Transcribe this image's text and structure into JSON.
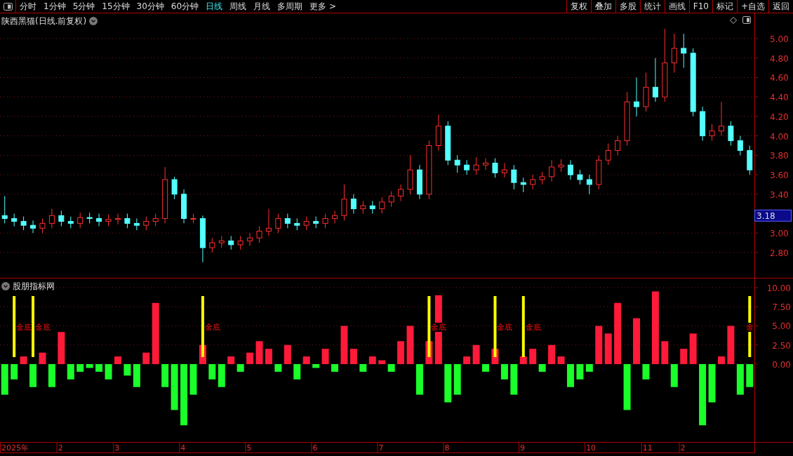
{
  "toolbar": {
    "periods": [
      {
        "label": "分时",
        "selected": false
      },
      {
        "label": "1分钟",
        "selected": false
      },
      {
        "label": "5分钟",
        "selected": false
      },
      {
        "label": "15分钟",
        "selected": false
      },
      {
        "label": "30分钟",
        "selected": false
      },
      {
        "label": "60分钟",
        "selected": false
      },
      {
        "label": "日线",
        "selected": true
      },
      {
        "label": "周线",
        "selected": false
      },
      {
        "label": "月线",
        "selected": false
      },
      {
        "label": "多周期",
        "selected": false
      },
      {
        "label": "更多 >",
        "selected": false
      }
    ],
    "actions": [
      "复权",
      "叠加",
      "多股",
      "统计",
      "画线",
      "F10",
      "标记",
      "+自选",
      "返回"
    ]
  },
  "price_panel": {
    "title": "陕西黑猫(日线.前复权)",
    "current_price": "3.18",
    "chart_data": {
      "type": "candlestick",
      "grid": true,
      "ylim": [
        2.54,
        5.26
      ],
      "categories": [
        null,
        null,
        null,
        null,
        null,
        null,
        null,
        null,
        null,
        null,
        null,
        null,
        null,
        null,
        null,
        null,
        null,
        null,
        null,
        null,
        null,
        null,
        null,
        null,
        null,
        null,
        null,
        null,
        null,
        null,
        null,
        null,
        null,
        null,
        null,
        null,
        null,
        null,
        null,
        null,
        null,
        null,
        null,
        null,
        null,
        null,
        null,
        null,
        null,
        null,
        null,
        null,
        null,
        null,
        null,
        null,
        null,
        null,
        null,
        null,
        null,
        null,
        null,
        null,
        null,
        null,
        null,
        null,
        null,
        null,
        null,
        null,
        null,
        null,
        null,
        null,
        null,
        null,
        null,
        null
      ],
      "yticks": [
        {
          "value": 2.8,
          "label": "2.80"
        },
        {
          "value": 3.0,
          "label": "3.00"
        },
        {
          "value": 3.4,
          "label": "3.40"
        },
        {
          "value": 3.6,
          "label": "3.60"
        },
        {
          "value": 3.8,
          "label": "3.80"
        },
        {
          "value": 4.0,
          "label": "4.00"
        },
        {
          "value": 4.2,
          "label": "4.20"
        },
        {
          "value": 4.4,
          "label": "4.40"
        },
        {
          "value": 4.6,
          "label": "4.60"
        },
        {
          "value": 4.8,
          "label": "4.80"
        },
        {
          "value": 5.0,
          "label": "5.00"
        }
      ],
      "ohlc": [
        [
          3.18,
          3.38,
          3.1,
          3.15
        ],
        [
          3.15,
          3.2,
          3.07,
          3.12
        ],
        [
          3.12,
          3.17,
          3.03,
          3.08
        ],
        [
          3.08,
          3.13,
          3.0,
          3.05
        ],
        [
          3.05,
          3.15,
          3.0,
          3.1
        ],
        [
          3.1,
          3.25,
          3.05,
          3.18
        ],
        [
          3.18,
          3.23,
          3.07,
          3.12
        ],
        [
          3.12,
          3.17,
          3.05,
          3.1
        ],
        [
          3.1,
          3.21,
          3.05,
          3.16
        ],
        [
          3.16,
          3.21,
          3.1,
          3.15
        ],
        [
          3.15,
          3.2,
          3.07,
          3.12
        ],
        [
          3.12,
          3.19,
          3.07,
          3.14
        ],
        [
          3.14,
          3.2,
          3.09,
          3.15
        ],
        [
          3.15,
          3.2,
          3.05,
          3.1
        ],
        [
          3.1,
          3.15,
          3.03,
          3.08
        ],
        [
          3.08,
          3.17,
          3.03,
          3.12
        ],
        [
          3.12,
          3.2,
          3.07,
          3.15
        ],
        [
          3.15,
          3.68,
          3.1,
          3.55
        ],
        [
          3.55,
          3.58,
          3.35,
          3.4
        ],
        [
          3.4,
          3.45,
          3.1,
          3.15
        ],
        [
          3.15,
          3.2,
          3.1,
          3.15
        ],
        [
          3.15,
          3.18,
          2.7,
          2.85
        ],
        [
          2.85,
          2.95,
          2.8,
          2.9
        ],
        [
          2.9,
          2.97,
          2.85,
          2.92
        ],
        [
          2.92,
          2.97,
          2.83,
          2.88
        ],
        [
          2.88,
          2.97,
          2.83,
          2.92
        ],
        [
          2.92,
          3.0,
          2.87,
          2.95
        ],
        [
          2.95,
          3.07,
          2.9,
          3.02
        ],
        [
          3.02,
          3.25,
          2.97,
          3.05
        ],
        [
          3.05,
          3.2,
          3.0,
          3.15
        ],
        [
          3.15,
          3.2,
          3.05,
          3.1
        ],
        [
          3.1,
          3.15,
          3.03,
          3.08
        ],
        [
          3.08,
          3.17,
          3.03,
          3.12
        ],
        [
          3.12,
          3.17,
          3.05,
          3.1
        ],
        [
          3.1,
          3.2,
          3.05,
          3.15
        ],
        [
          3.15,
          3.23,
          3.1,
          3.18
        ],
        [
          3.18,
          3.5,
          3.13,
          3.35
        ],
        [
          3.35,
          3.4,
          3.2,
          3.25
        ],
        [
          3.25,
          3.33,
          3.2,
          3.28
        ],
        [
          3.28,
          3.33,
          3.2,
          3.25
        ],
        [
          3.25,
          3.37,
          3.2,
          3.32
        ],
        [
          3.32,
          3.43,
          3.27,
          3.38
        ],
        [
          3.38,
          3.5,
          3.33,
          3.45
        ],
        [
          3.45,
          3.8,
          3.4,
          3.65
        ],
        [
          3.65,
          3.7,
          3.35,
          3.4
        ],
        [
          3.4,
          3.95,
          3.35,
          3.9
        ],
        [
          3.9,
          4.22,
          3.85,
          4.1
        ],
        [
          4.1,
          4.15,
          3.7,
          3.75
        ],
        [
          3.75,
          3.8,
          3.62,
          3.7
        ],
        [
          3.7,
          3.75,
          3.6,
          3.65
        ],
        [
          3.65,
          3.78,
          3.6,
          3.7
        ],
        [
          3.7,
          3.77,
          3.65,
          3.72
        ],
        [
          3.72,
          3.77,
          3.57,
          3.62
        ],
        [
          3.62,
          3.72,
          3.57,
          3.65
        ],
        [
          3.65,
          3.7,
          3.45,
          3.52
        ],
        [
          3.52,
          3.57,
          3.42,
          3.5
        ],
        [
          3.5,
          3.6,
          3.45,
          3.55
        ],
        [
          3.55,
          3.63,
          3.5,
          3.58
        ],
        [
          3.58,
          3.75,
          3.53,
          3.68
        ],
        [
          3.68,
          3.76,
          3.63,
          3.7
        ],
        [
          3.7,
          3.75,
          3.55,
          3.6
        ],
        [
          3.6,
          3.65,
          3.5,
          3.55
        ],
        [
          3.55,
          3.6,
          3.4,
          3.5
        ],
        [
          3.5,
          3.8,
          3.45,
          3.75
        ],
        [
          3.75,
          3.92,
          3.7,
          3.85
        ],
        [
          3.85,
          4.0,
          3.8,
          3.95
        ],
        [
          3.95,
          4.45,
          3.9,
          4.35
        ],
        [
          4.35,
          4.6,
          4.2,
          4.3
        ],
        [
          4.3,
          4.65,
          4.25,
          4.5
        ],
        [
          4.5,
          4.8,
          4.35,
          4.4
        ],
        [
          4.4,
          5.1,
          4.35,
          4.75
        ],
        [
          4.75,
          5.05,
          4.65,
          4.9
        ],
        [
          4.9,
          5.05,
          4.7,
          4.85
        ],
        [
          4.85,
          4.9,
          4.2,
          4.25
        ],
        [
          4.25,
          4.3,
          3.95,
          4.0
        ],
        [
          4.0,
          4.12,
          3.95,
          4.05
        ],
        [
          4.05,
          4.35,
          4.0,
          4.1
        ],
        [
          4.1,
          4.15,
          3.9,
          3.95
        ],
        [
          3.95,
          4.0,
          3.8,
          3.85
        ],
        [
          3.85,
          3.9,
          3.6,
          3.65
        ]
      ]
    }
  },
  "indicator_panel": {
    "title": "股朋指标网",
    "signals": [
      "金底",
      "金底",
      "金底",
      "金底",
      "金底",
      "金底",
      "金"
    ],
    "date_axis": [
      "2025年",
      "2",
      "3",
      "4",
      "5",
      "6",
      "7",
      "8",
      "9",
      "10",
      "11",
      "2"
    ],
    "chart_data": {
      "type": "bar",
      "grid": true,
      "ylim": [
        -10.18,
        11.19
      ],
      "yticks": [
        {
          "value": 0,
          "label": "0.00"
        },
        {
          "value": 2.5,
          "label": "2.50"
        },
        {
          "value": 5,
          "label": "5.00"
        },
        {
          "value": 7.5,
          "label": "7.50"
        },
        {
          "value": 10,
          "label": "10.00"
        }
      ],
      "values": [
        -4,
        -2,
        1,
        -3,
        1.5,
        -3,
        4.2,
        -2,
        -1,
        -0.5,
        -1,
        -2,
        1,
        -1.5,
        -3,
        1.5,
        8,
        -3,
        -6,
        -8,
        -4,
        2.5,
        -2,
        -3,
        1,
        -1,
        1.5,
        3,
        2,
        -1,
        2.5,
        -2,
        1,
        -0.5,
        2,
        -1,
        5,
        2,
        -1,
        1,
        0.5,
        -1,
        3,
        5,
        -4,
        3,
        9,
        -5,
        -4,
        1,
        2.5,
        -1,
        2,
        -2,
        -4,
        1,
        2,
        -1,
        2.5,
        1,
        -3,
        -2,
        -1,
        5,
        4,
        8,
        -6,
        6,
        -2,
        9.5,
        3,
        -3,
        2,
        4,
        -8,
        -5,
        1,
        5,
        -4,
        -3
      ]
    }
  }
}
